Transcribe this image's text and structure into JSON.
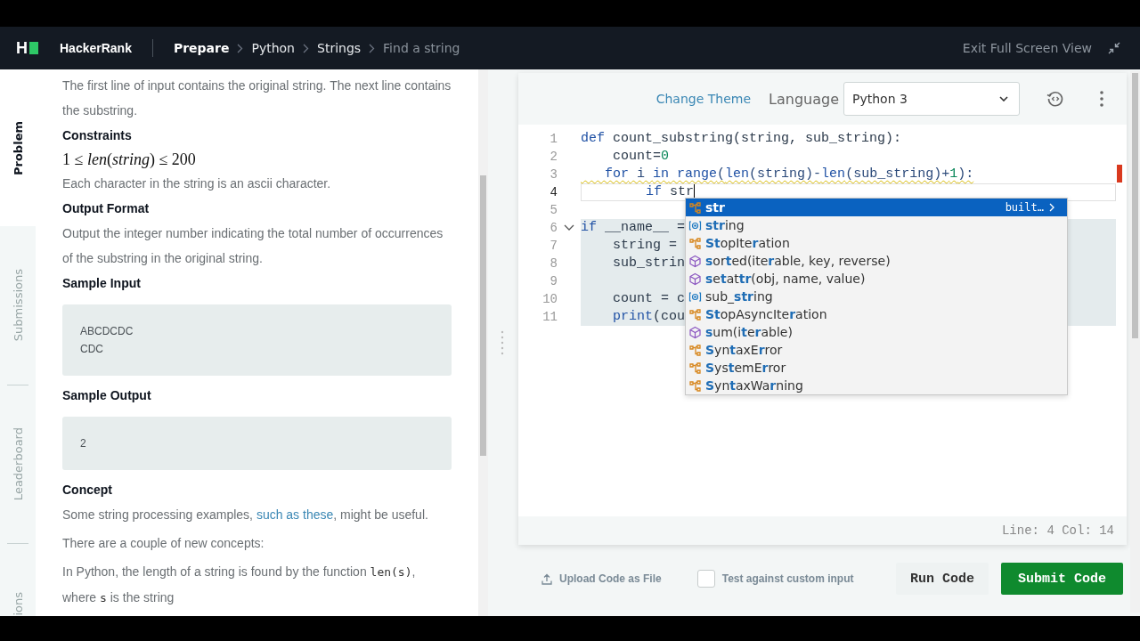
{
  "header": {
    "logo_letter": "H",
    "brand": "HackerRank",
    "breadcrumbs": [
      {
        "label": "Prepare",
        "kind": "root"
      },
      {
        "label": "Python",
        "kind": "link"
      },
      {
        "label": "Strings",
        "kind": "link"
      },
      {
        "label": "Find a string",
        "kind": "current"
      }
    ],
    "exit_label": "Exit Full Screen View"
  },
  "side_tabs": [
    {
      "label": "Problem",
      "selected": true
    },
    {
      "label": "Submissions",
      "selected": false
    },
    {
      "label": "Leaderboard",
      "selected": false
    },
    {
      "label": "ions",
      "selected": false
    }
  ],
  "problem": {
    "blocks": [
      {
        "kind": "para",
        "text": "The first line of input contains the original string. The next line contains the substring."
      },
      {
        "kind": "heading",
        "text": "Constraints"
      },
      {
        "kind": "math",
        "text": "1 ≤ *len*(*string*) ≤ 200"
      },
      {
        "kind": "para",
        "text": "Each character in the string is an ascii character."
      },
      {
        "kind": "heading",
        "text": "Output Format"
      },
      {
        "kind": "para",
        "text": "Output the integer number indicating the total number of occurrences of the substring in the original string."
      },
      {
        "kind": "heading",
        "text": "Sample Input"
      },
      {
        "kind": "sample",
        "lines": [
          "ABCDCDC",
          "CDC"
        ]
      },
      {
        "kind": "heading",
        "text": "Sample Output"
      },
      {
        "kind": "sample",
        "lines": [
          "2"
        ]
      },
      {
        "kind": "heading",
        "text": "Concept"
      },
      {
        "kind": "rich",
        "parts": [
          {
            "text": "Some string processing examples, ",
            "kind": "plain"
          },
          {
            "text": "such as these",
            "kind": "link"
          },
          {
            "text": ", might be useful.",
            "kind": "plain"
          }
        ]
      },
      {
        "kind": "para",
        "text": "There are a couple of new concepts:"
      },
      {
        "kind": "rich",
        "parts": [
          {
            "text": "In Python, the length of a string is found by the function ",
            "kind": "plain"
          },
          {
            "text": "len(s)",
            "kind": "code"
          },
          {
            "text": ", where ",
            "kind": "plain"
          },
          {
            "text": "s",
            "kind": "code"
          },
          {
            "text": " is the string",
            "kind": "plain"
          }
        ]
      }
    ]
  },
  "editor": {
    "change_theme": "Change Theme",
    "language_label": "Language",
    "language": "Python 3",
    "lines": [
      {
        "number": "1",
        "current": false,
        "selected": false,
        "warning": false,
        "foldable": false,
        "tokens": [
          {
            "text": "def",
            "kind": "keyword"
          },
          {
            "text": " count_substring(string, sub_string):",
            "kind": "plain"
          }
        ]
      },
      {
        "number": "2",
        "current": false,
        "selected": false,
        "warning": false,
        "foldable": false,
        "tokens": [
          {
            "text": "    count=",
            "kind": "plain"
          },
          {
            "text": "0",
            "kind": "number"
          }
        ]
      },
      {
        "number": "3",
        "current": false,
        "selected": false,
        "warning": true,
        "foldable": false,
        "tokens": [
          {
            "text": "   for",
            "kind": "keyword"
          },
          {
            "text": " i ",
            "kind": "plain"
          },
          {
            "text": "in",
            "kind": "keyword"
          },
          {
            "text": " range",
            "kind": "builtin"
          },
          {
            "text": "(",
            "kind": "plain"
          },
          {
            "text": "len",
            "kind": "builtin"
          },
          {
            "text": "(string)-",
            "kind": "plain"
          },
          {
            "text": "len",
            "kind": "builtin"
          },
          {
            "text": "(sub_string)+",
            "kind": "plain"
          },
          {
            "text": "1",
            "kind": "number"
          },
          {
            "text": "):",
            "kind": "plain"
          }
        ]
      },
      {
        "number": "4",
        "current": true,
        "selected": false,
        "warning": false,
        "foldable": false,
        "tokens": [
          {
            "text": "        if",
            "kind": "keyword"
          },
          {
            "text": " str",
            "kind": "plain"
          }
        ]
      },
      {
        "number": "5",
        "current": false,
        "selected": false,
        "warning": false,
        "foldable": false
      },
      {
        "number": "6",
        "current": false,
        "selected": true,
        "warning": false,
        "foldable": true,
        "tokens": [
          {
            "text": "if",
            "kind": "keyword"
          },
          {
            "text": " __name__ =",
            "kind": "plain"
          }
        ]
      },
      {
        "number": "7",
        "current": false,
        "selected": true,
        "warning": false,
        "foldable": false,
        "tokens": [
          {
            "text": "    string =",
            "kind": "plain"
          }
        ]
      },
      {
        "number": "8",
        "current": false,
        "selected": true,
        "warning": false,
        "foldable": false,
        "tokens": [
          {
            "text": "    sub_strin",
            "kind": "plain"
          }
        ]
      },
      {
        "number": "9",
        "current": false,
        "selected": true,
        "warning": false,
        "foldable": false
      },
      {
        "number": "10",
        "current": false,
        "selected": true,
        "warning": false,
        "foldable": false,
        "tokens": [
          {
            "text": "    count = c",
            "kind": "plain"
          }
        ]
      },
      {
        "number": "11",
        "current": false,
        "selected": true,
        "warning": false,
        "foldable": false,
        "tokens": [
          {
            "text": "    print",
            "kind": "builtin"
          },
          {
            "text": "(cou",
            "kind": "plain"
          }
        ]
      }
    ],
    "suggestions": [
      {
        "label": "**str**",
        "kind": "class",
        "selected": true,
        "detail": "built…"
      },
      {
        "label": "**str**ing",
        "kind": "variable",
        "selected": false
      },
      {
        "label": "**St**opIte**r**ation",
        "kind": "class",
        "selected": false
      },
      {
        "label": "**s**or**t**ed(ite**r**able, key, reverse)",
        "kind": "method",
        "selected": false
      },
      {
        "label": "**s**e**t**at**tr**(obj, name, value)",
        "kind": "method",
        "selected": false
      },
      {
        "label": "sub_**str**ing",
        "kind": "variable",
        "selected": false
      },
      {
        "label": "**St**opAsyncIte**r**ation",
        "kind": "class",
        "selected": false
      },
      {
        "label": "**s**um(i**t**e**r**able)",
        "kind": "method",
        "selected": false
      },
      {
        "label": "**S**yn**t**axE**r**ror",
        "kind": "class",
        "selected": false
      },
      {
        "label": "**S**ys**t**emE**r**ror",
        "kind": "class",
        "selected": false
      },
      {
        "label": "**S**yn**t**axWa**r**ning",
        "kind": "class",
        "selected": false
      }
    ],
    "status": "Line: 4 Col: 14"
  },
  "actions": {
    "upload": "Upload Code as File",
    "custom_input": {
      "label": "Test against custom input",
      "checked": false
    },
    "run": "Run Code",
    "submit": "Submit Code"
  }
}
